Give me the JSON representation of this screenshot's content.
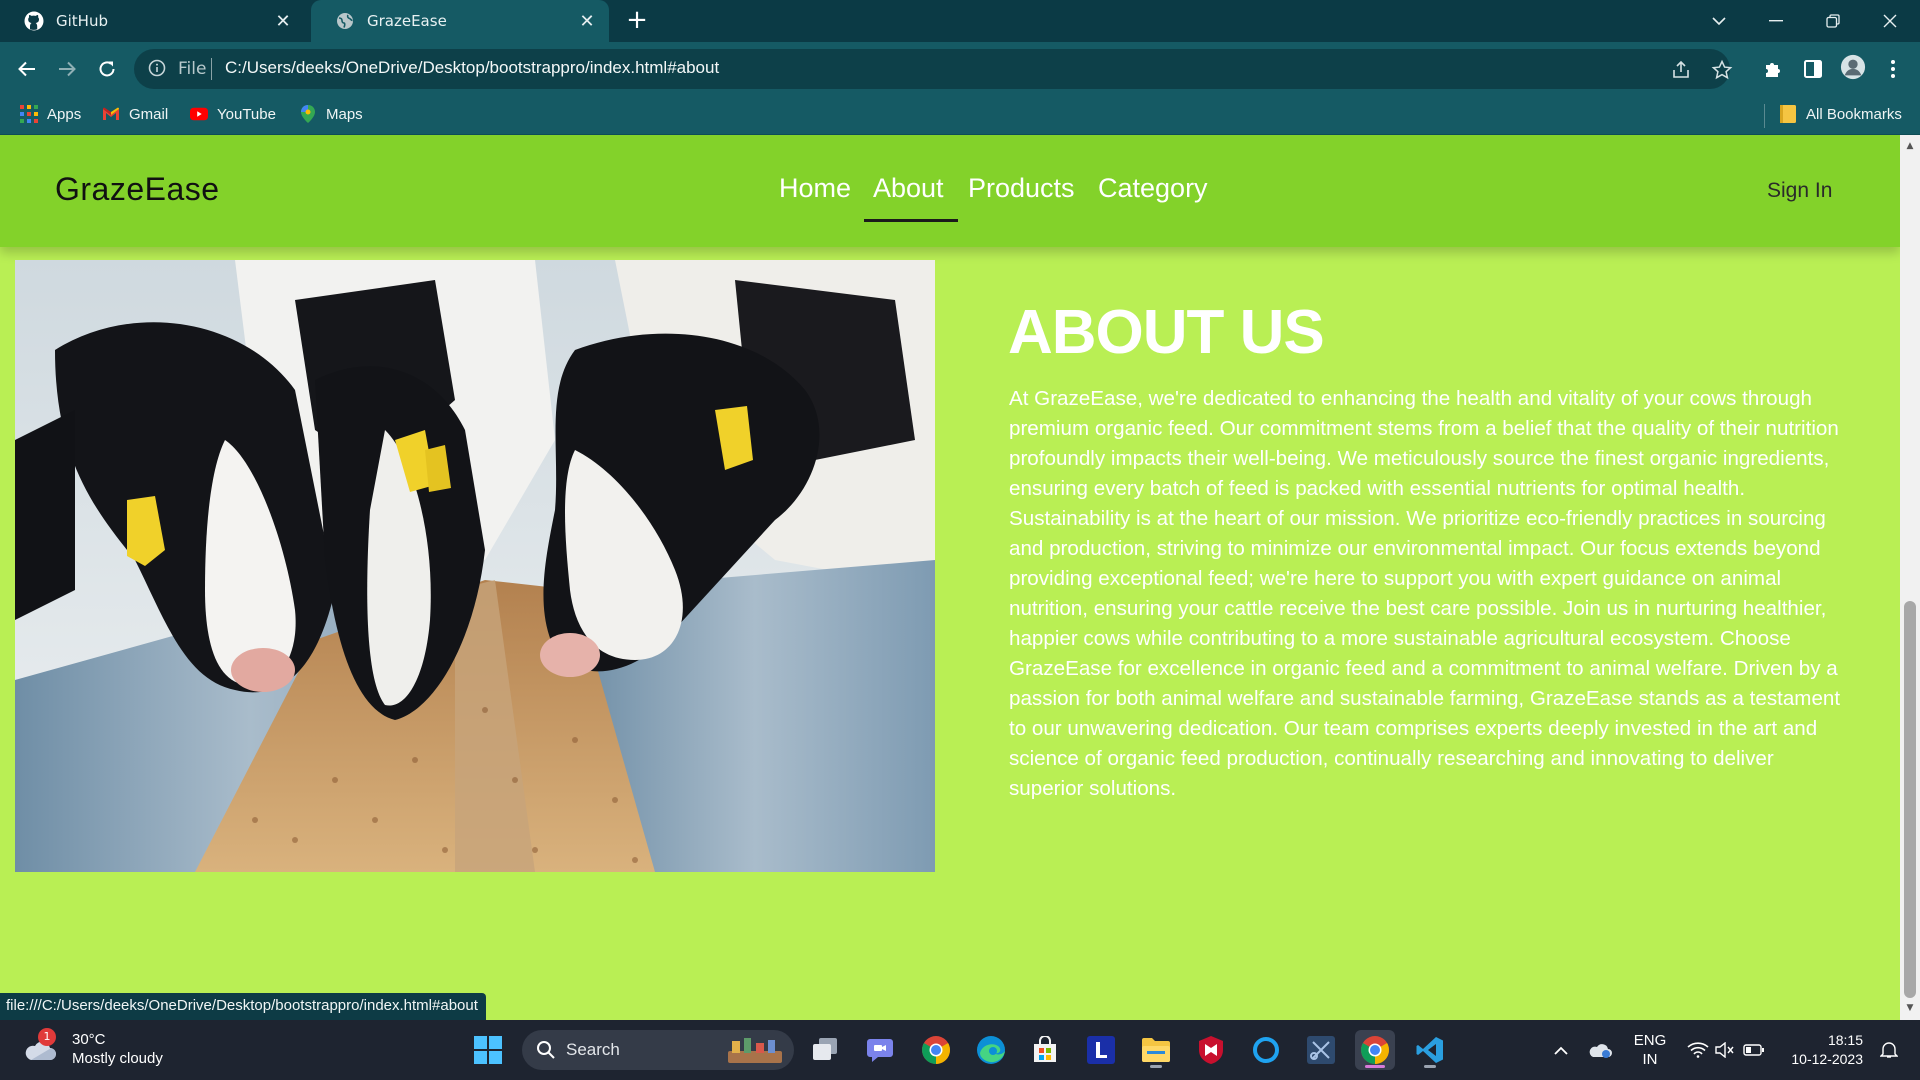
{
  "browser": {
    "tabs": [
      {
        "title": "GitHub",
        "icon": "github-icon",
        "active": false
      },
      {
        "title": "GrazeEase",
        "icon": "globe-icon",
        "active": true
      }
    ],
    "new_tab": "+",
    "address": {
      "scheme": "File",
      "url": "C:/Users/deeks/OneDrive/Desktop/bootstrappro/index.html#about"
    },
    "bookmarks": [
      {
        "label": "Apps",
        "icon": "apps-grid-icon"
      },
      {
        "label": "Gmail",
        "icon": "gmail-icon"
      },
      {
        "label": "YouTube",
        "icon": "youtube-icon"
      },
      {
        "label": "Maps",
        "icon": "maps-icon"
      }
    ],
    "all_bookmarks": "All Bookmarks",
    "status_url": "file:///C:/Users/deeks/OneDrive/Desktop/bootstrappro/index.html#about"
  },
  "site": {
    "brand": "GrazeEase",
    "nav": [
      {
        "label": "Home",
        "active": false
      },
      {
        "label": "About",
        "active": true
      },
      {
        "label": "Products",
        "active": false
      },
      {
        "label": "Category",
        "active": false
      }
    ],
    "sign_in": "Sign In",
    "about": {
      "title": "ABOUT US",
      "body": "At GrazeEase, we're dedicated to enhancing the health and vitality of your cows through premium organic feed. Our commitment stems from a belief that the quality of their nutrition profoundly impacts their well-being. We meticulously source the finest organic ingredients, ensuring every batch of feed is packed with essential nutrients for optimal health. Sustainability is at the heart of our mission. We prioritize eco-friendly practices in sourcing and production, striving to minimize our environmental impact. Our focus extends beyond providing exceptional feed; we're here to support you with expert guidance on animal nutrition, ensuring your cattle receive the best care possible. Join us in nurturing healthier, happier cows while contributing to a more sustainable agricultural ecosystem. Choose GrazeEase for excellence in organic feed and a commitment to animal welfare. Driven by a passion for both animal welfare and sustainable farming, GrazeEase stands as a testament to our unwavering dedication. Our team comprises experts deeply invested in the art and science of organic feed production, continually researching and innovating to deliver superior solutions."
    },
    "colors": {
      "navbar": "#83d22a",
      "background": "#b9ef54",
      "text": "#ffffff"
    }
  },
  "taskbar": {
    "weather": {
      "temp": "30°C",
      "desc": "Mostly cloudy",
      "badge": "1"
    },
    "search_label": "Search",
    "language": {
      "lang": "ENG",
      "region": "IN"
    },
    "clock": {
      "time": "18:15",
      "date": "10-12-2023"
    }
  }
}
